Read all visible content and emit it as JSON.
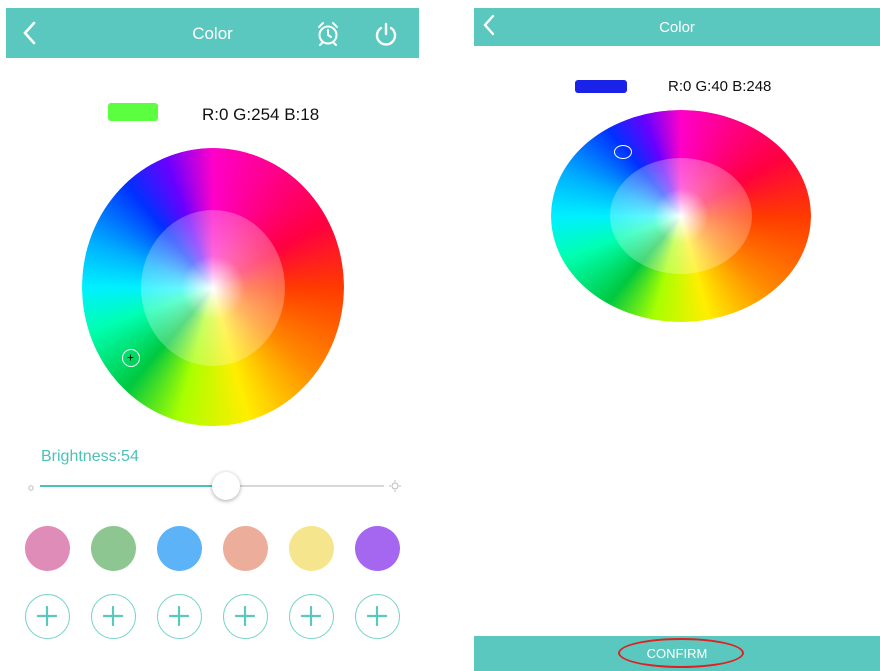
{
  "left": {
    "header": {
      "title": "Color",
      "back_icon": "chevron-left-icon",
      "alarm_icon": "alarm-clock-icon",
      "power_icon": "power-icon"
    },
    "current_color": {
      "swatch_color": "#5cff40",
      "rgb_text": "R:0 G:254 B:18"
    },
    "brightness": {
      "label": "Brightness:54",
      "value": 54
    },
    "presets": [
      {
        "color": "#e08cb8"
      },
      {
        "color": "#8dc690"
      },
      {
        "color": "#5cb3f8"
      },
      {
        "color": "#ecad9b"
      },
      {
        "color": "#f5e68e"
      },
      {
        "color": "#a566f0"
      }
    ],
    "add_buttons": [
      "+",
      "+",
      "+",
      "+",
      "+",
      "+"
    ]
  },
  "right": {
    "header": {
      "title": "Color",
      "back_icon": "chevron-left-icon"
    },
    "current_color": {
      "swatch_color": "#1a22e8",
      "rgb_text": "R:0 G:40 B:248"
    },
    "confirm": {
      "label": "CONFIRM",
      "highlight_color": "#e02020"
    }
  },
  "colors": {
    "accent": "#5ac8be",
    "accent_text": "#4cc2b7"
  }
}
